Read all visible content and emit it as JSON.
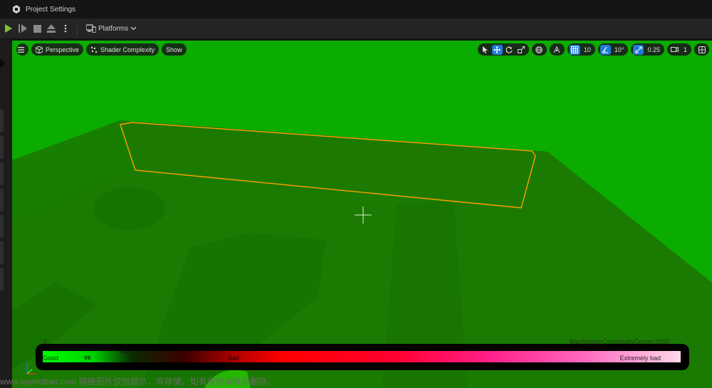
{
  "window": {
    "title": "Project Settings",
    "logo_icon": "unreal-logo-icon"
  },
  "toolbar": {
    "buttons": [
      "play-icon",
      "step-icon",
      "stop-icon",
      "eject-icon",
      "more-icon"
    ],
    "platforms_label": "Platforms"
  },
  "viewport": {
    "menu_icon": "hamburger-icon",
    "view_mode": "Perspective",
    "shading_mode": "Shader Complexity",
    "show_label": "Show",
    "grid_snap": "10",
    "rotation_snap": "10°",
    "scale_snap": "0.25",
    "camera_speed": "1",
    "colors": {
      "background": "#0aac00",
      "floor": "#1a7a02",
      "selection": "#ff9d00"
    }
  },
  "legend": {
    "min_label": "0",
    "max_label": "MaxShaderComplexityCount=2000",
    "good_label": "Good",
    "bad_label": "Bad",
    "extremely_bad_label": "Extremely bad",
    "ps_marker": "PS",
    "vs_marker": "VS"
  },
  "watermark": "www.toymoban.com 网络图片仅供展示，非存储，如有侵权请联系删除。"
}
